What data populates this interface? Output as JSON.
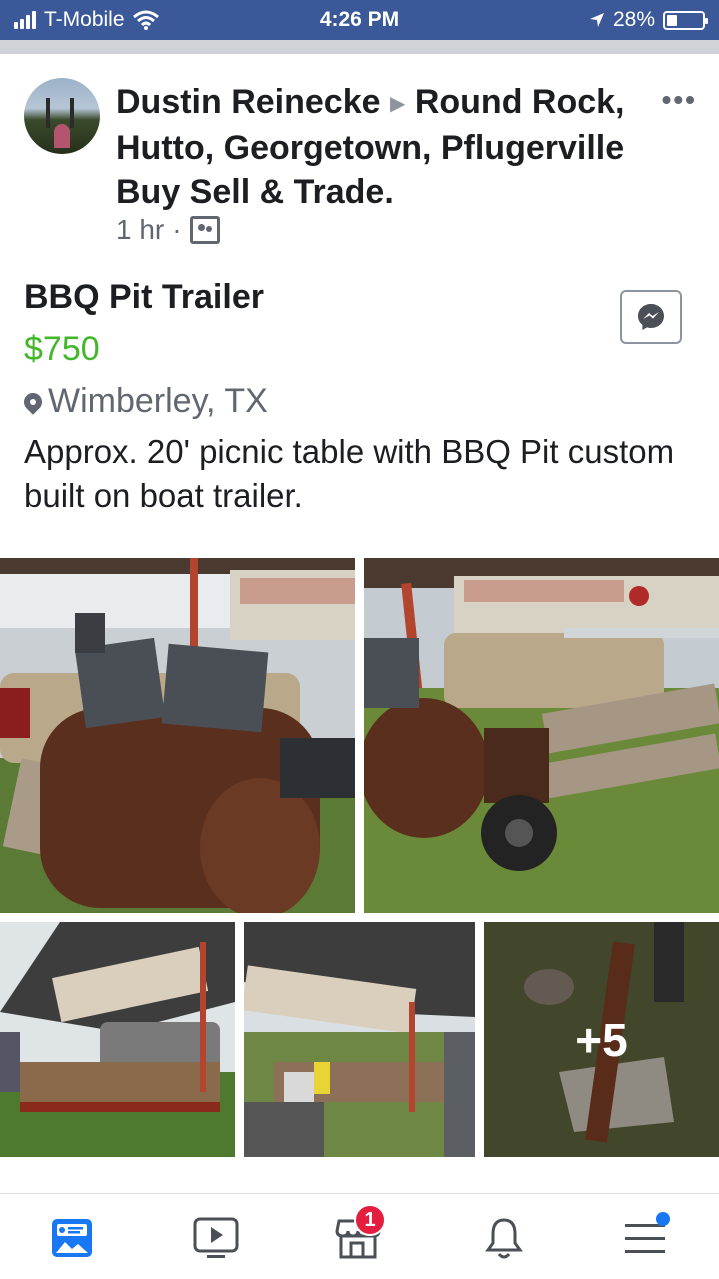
{
  "status_bar": {
    "carrier": "T-Mobile",
    "time": "4:26 PM",
    "battery": "28%",
    "battery_level": 0.28,
    "icons": [
      "signal-icon",
      "wifi-icon",
      "location-arrow-icon",
      "battery-icon"
    ]
  },
  "post": {
    "author": "Dustin Reinecke",
    "group": "Round Rock, Hutto, Georgetown, Pflugerville Buy Sell & Trade.",
    "time_ago": "1 hr",
    "separator": "·",
    "more": "•••",
    "listing": {
      "title": "BBQ Pit Trailer",
      "price": "$750",
      "location": "Wimberley, TX",
      "description": "Approx. 20' picnic table with BBQ Pit custom built on boat trailer."
    },
    "photos": {
      "more_count": "+5"
    }
  },
  "tabbar": {
    "items": [
      {
        "name": "news-feed",
        "active": true
      },
      {
        "name": "watch"
      },
      {
        "name": "marketplace",
        "badge": "1"
      },
      {
        "name": "notifications"
      },
      {
        "name": "menu"
      }
    ]
  },
  "colors": {
    "status_bar_bg": "#3b5998",
    "price": "#42b72a",
    "active_tab": "#1877f2",
    "badge": "#e41e3f"
  }
}
